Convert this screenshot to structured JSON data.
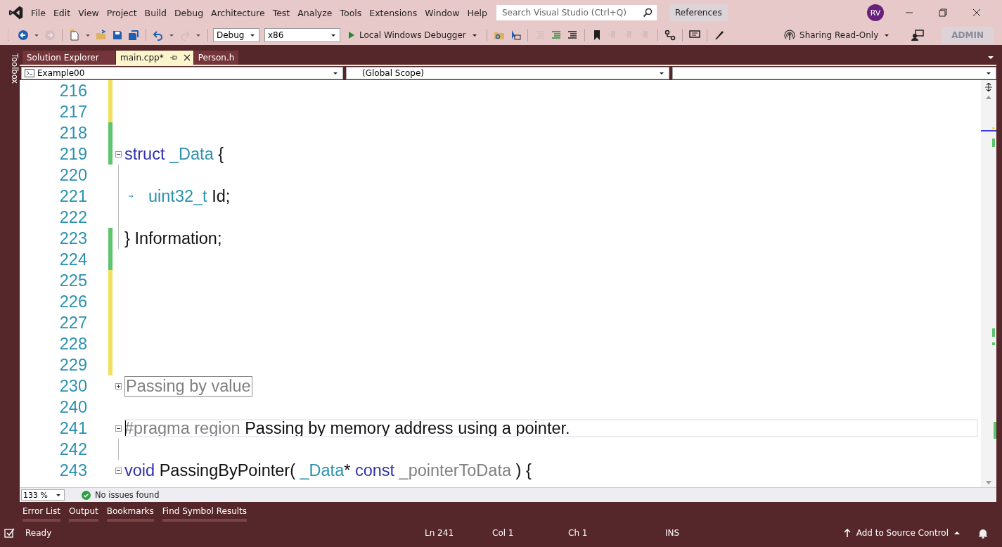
{
  "menu": [
    "File",
    "Edit",
    "View",
    "Project",
    "Build",
    "Debug",
    "Architecture",
    "Test",
    "Analyze",
    "Tools",
    "Extensions",
    "Window",
    "Help"
  ],
  "search": {
    "placeholder": "Search Visual Studio (Ctrl+Q)"
  },
  "references_button": "References",
  "avatar": "RV",
  "toolbar": {
    "buttons": [
      {
        "disabled": false
      },
      {
        "disabled": true
      },
      {
        "disabled": false
      },
      {
        "disabled": false
      },
      {
        "disabled": false
      },
      {
        "disabled": false
      },
      {
        "disabled": false
      },
      {
        "disabled": true
      }
    ],
    "configuration": "Debug",
    "platform": "x86",
    "run_target": "Local Windows Debugger",
    "buttons_right": [
      {
        "disabled": false
      },
      {
        "disabled": false
      },
      {
        "disabled": true
      },
      {
        "disabled": false
      },
      {
        "disabled": false
      },
      {
        "disabled": false
      },
      {
        "disabled": true
      },
      {
        "disabled": true
      },
      {
        "disabled": true
      },
      {
        "disabled": false
      },
      {
        "disabled": false
      },
      {
        "disabled": false
      }
    ],
    "sharing": "Sharing Read-Only",
    "admin_badge": "ADMIN"
  },
  "toolbox_label": "Toolbox",
  "tabs": [
    {
      "label": "Solution Explorer",
      "selected": false,
      "pinned": false
    },
    {
      "label": "main.cpp*",
      "selected": true,
      "pinned": true
    },
    {
      "label": "Person.h",
      "selected": false,
      "pinned": false
    }
  ],
  "navigation": {
    "project": "Example00",
    "scope": "(Global Scope)"
  },
  "code_lines": [
    {
      "number": "216",
      "color": "#f2e05c",
      "current": false
    },
    {
      "number": "217",
      "color": "#f2e05c",
      "current": false
    },
    {
      "number": "218",
      "color": "#5ec46e",
      "current": false
    },
    {
      "number": "219",
      "color": "#5ec46e",
      "expanded": true,
      "current": false,
      "tokens": [
        {
          "kind": "keyword",
          "text": "struct"
        },
        {
          "kind": "type",
          "text": " _Data"
        },
        {
          "kind": "plain",
          "text": " {"
        }
      ]
    },
    {
      "number": "220",
      "in_block": true,
      "current": false
    },
    {
      "number": "221",
      "in_block": true,
      "indent": true,
      "current": false,
      "tokens": [
        {
          "kind": "type",
          "text": "uint32_t"
        },
        {
          "kind": "plain",
          "text": " Id;"
        }
      ]
    },
    {
      "number": "222",
      "in_block": true,
      "current": false
    },
    {
      "number": "223",
      "color": "#5ec46e",
      "in_block": true,
      "current": false,
      "tokens": [
        {
          "kind": "plain",
          "text": "} Information;"
        }
      ]
    },
    {
      "number": "224",
      "color": "#5ec46e",
      "current": false
    },
    {
      "number": "225",
      "color": "#f2e05c",
      "current": false
    },
    {
      "number": "226",
      "color": "#f2e05c",
      "current": false
    },
    {
      "number": "227",
      "color": "#f2e05c",
      "current": false
    },
    {
      "number": "228",
      "color": "#f2e05c",
      "current": false
    },
    {
      "number": "229",
      "color": "#f2e05c",
      "current": false
    },
    {
      "number": "230",
      "expanded": false,
      "current": false,
      "tokens": [
        {
          "kind": "collapsed",
          "text": "Passing by value"
        }
      ]
    },
    {
      "number": "240",
      "current": false
    },
    {
      "number": "241",
      "expanded": true,
      "current": true,
      "tokens": [
        {
          "kind": "preproc",
          "text": "#pragma region"
        },
        {
          "kind": "plain",
          "text": " Passing by memory address using a pointer."
        }
      ]
    },
    {
      "number": "242",
      "in_block": true,
      "current": false
    },
    {
      "number": "243",
      "expanded": true,
      "current": false,
      "tokens": [
        {
          "kind": "keyword",
          "text": "void"
        },
        {
          "kind": "plain",
          "text": " PassingByPointer( "
        },
        {
          "kind": "type",
          "text": "_Data"
        },
        {
          "kind": "plain",
          "text": "* "
        },
        {
          "kind": "keyword",
          "text": "const"
        },
        {
          "kind": "param",
          "text": " _pointerToData"
        },
        {
          "kind": "plain",
          "text": " ) {"
        }
      ]
    }
  ],
  "editor_status": {
    "zoom": "133 %",
    "issues": "No issues found"
  },
  "tool_tabs": [
    "Error List",
    "Output",
    "Bookmarks",
    "Find Symbol Results"
  ],
  "status_bar": {
    "state": "Ready",
    "line": "Ln 241",
    "column": "Col 1",
    "char": "Ch 1",
    "mode": "INS",
    "source_control": "Add to Source Control"
  }
}
